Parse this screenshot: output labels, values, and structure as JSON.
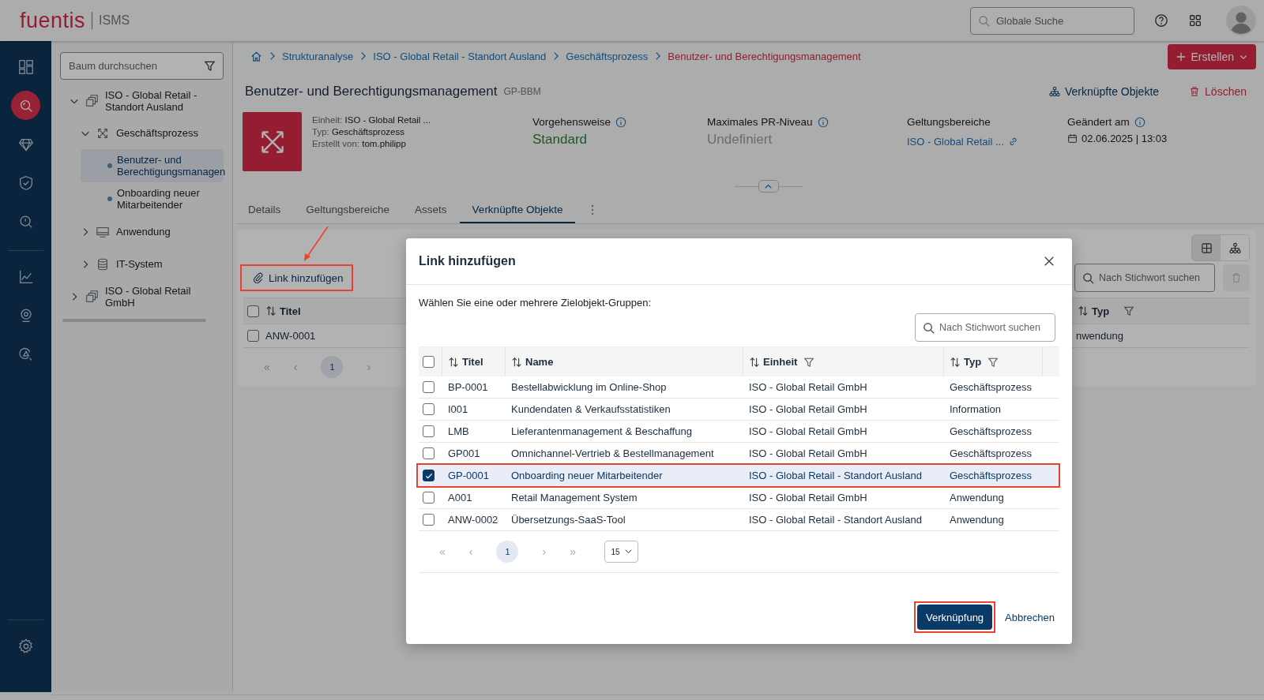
{
  "header": {
    "logo": "fuentis",
    "product": "ISMS",
    "search": {
      "placeholder": "Globale Suche"
    }
  },
  "nav_rail": {
    "top": [
      {
        "kind": "dashboard",
        "selected": false
      },
      {
        "kind": "search",
        "selected": true
      },
      {
        "kind": "gem",
        "selected": false
      },
      {
        "kind": "shield",
        "selected": false
      },
      {
        "kind": "alert-search",
        "selected": false
      }
    ],
    "middle": [
      {
        "kind": "chart",
        "selected": false
      },
      {
        "kind": "webcam",
        "selected": false
      },
      {
        "kind": "risk-search",
        "selected": false
      }
    ],
    "bottom": [
      {
        "kind": "settings",
        "selected": false
      }
    ]
  },
  "tree": {
    "search": {
      "placeholder": "Baum durchsuchen"
    },
    "items": [
      {
        "label": "ISO - Global Retail - Standort Ausland",
        "kind": "group",
        "expanded": true,
        "children": [
          {
            "label": "Geschäftsprozess",
            "kind": "process",
            "expanded": true,
            "children": [
              {
                "label": "Benutzer- und Berechtigungsmanagen",
                "kind": "leaf",
                "selected": true
              },
              {
                "label": "Onboarding neuer Mitarbeitender",
                "kind": "leaf",
                "selected": false
              }
            ]
          },
          {
            "label": "Anwendung",
            "kind": "application",
            "expanded": false
          },
          {
            "label": "IT-System",
            "kind": "database",
            "expanded": false
          }
        ]
      },
      {
        "label": "ISO - Global Retail GmbH",
        "kind": "group",
        "expanded": false
      }
    ]
  },
  "breadcrumb": [
    {
      "label": "Strukturanalyse",
      "current": false
    },
    {
      "label": "ISO - Global Retail - Standort Ausland",
      "current": false
    },
    {
      "label": "Geschäftsprozess",
      "current": false
    },
    {
      "label": "Benutzer- und Berechtigungsmanagement",
      "current": true
    }
  ],
  "create_button": "Erstellen",
  "object": {
    "title": "Benutzer- und Berechtigungsmanagement",
    "code": "GP-BBM",
    "actions": [
      {
        "label": "Verknüpfte Objekte",
        "kind": "links"
      },
      {
        "label": "Löschen",
        "kind": "delete"
      }
    ],
    "meta": [
      {
        "label": "Einheit:",
        "value": "ISO - Global Retail ..."
      },
      {
        "label": "Typ:",
        "value": "Geschäftsprozess"
      },
      {
        "label": "Erstellt von:",
        "value": "tom.philipp"
      }
    ],
    "fields": [
      {
        "label": "Vorgehensweise",
        "info": true,
        "kind": "status",
        "value": "Standard"
      },
      {
        "label": "Maximales PR-Niveau",
        "info": true,
        "kind": "empty",
        "value": "Undefiniert"
      },
      {
        "label": "Geltungsbereiche",
        "info": false,
        "kind": "link",
        "value": "ISO - Global Retail ..."
      },
      {
        "label": "Geändert am",
        "info": true,
        "kind": "date",
        "value": "02.06.2025 | 13:03"
      }
    ]
  },
  "tabs": [
    {
      "label": "Details",
      "selected": false
    },
    {
      "label": "Geltungsbereiche",
      "selected": false
    },
    {
      "label": "Assets",
      "selected": false
    },
    {
      "label": "Verknüpfte Objekte",
      "selected": true
    }
  ],
  "linked": {
    "add_button": {
      "label": "Link hinzufügen",
      "highlighted": true
    },
    "view_toggle": [
      {
        "kind": "table",
        "selected": true
      },
      {
        "kind": "hierarchy",
        "selected": false
      }
    ],
    "search": {
      "placeholder": "Nach Stichwort suchen"
    },
    "columns": [
      {
        "label": "Titel",
        "filter": false
      },
      {
        "label": "Typ",
        "filter": true
      }
    ],
    "all_checked": false,
    "rows": [
      {
        "title": "ANW-0001",
        "type": "nwendung",
        "checked": false
      }
    ],
    "pagination": {
      "first": "«",
      "prev": "‹",
      "next": "›",
      "pages": [
        {
          "label": "1",
          "selected": true
        }
      ]
    }
  },
  "dialog": {
    "title": "Link hinzufügen",
    "instruction": "Wählen Sie eine oder mehrere Zielobjekt-Gruppen:",
    "search": {
      "placeholder": "Nach Stichwort suchen"
    },
    "columns": [
      {
        "label": "Titel",
        "filter": false
      },
      {
        "label": "Name",
        "filter": false
      },
      {
        "label": "Einheit",
        "filter": true
      },
      {
        "label": "Typ",
        "filter": true
      }
    ],
    "all_checked": false,
    "rows": [
      {
        "cells": [
          "BP-0001",
          "Bestellabwicklung im Online-Shop",
          "ISO - Global Retail GmbH",
          "Geschäftsprozess"
        ],
        "selected": false,
        "highlighted": false
      },
      {
        "cells": [
          "I001",
          "Kundendaten & Verkaufsstatistiken",
          "ISO - Global Retail GmbH",
          "Information"
        ],
        "selected": false,
        "highlighted": false
      },
      {
        "cells": [
          "LMB",
          "Lieferantenmanagement & Beschaffung",
          "ISO - Global Retail GmbH",
          "Geschäftsprozess"
        ],
        "selected": false,
        "highlighted": false
      },
      {
        "cells": [
          "GP001",
          "Omnichannel-Vertrieb & Bestellmanagement",
          "ISO - Global Retail GmbH",
          "Geschäftsprozess"
        ],
        "selected": false,
        "highlighted": false
      },
      {
        "cells": [
          "GP-0001",
          "Onboarding neuer Mitarbeitender",
          "ISO - Global Retail - Standort Ausland",
          "Geschäftsprozess"
        ],
        "selected": true,
        "highlighted": true
      },
      {
        "cells": [
          "A001",
          "Retail Management System",
          "ISO - Global Retail GmbH",
          "Anwendung"
        ],
        "selected": false,
        "highlighted": false
      },
      {
        "cells": [
          "ANW-0002",
          "Übersetzungs-SaaS-Tool",
          "ISO - Global Retail - Standort Ausland",
          "Anwendung"
        ],
        "selected": false,
        "highlighted": false
      }
    ],
    "pagination": {
      "first": "«",
      "prev": "‹",
      "next": "›",
      "last": "»",
      "pages": [
        {
          "label": "1",
          "selected": true
        }
      ],
      "page_size": "15"
    },
    "buttons": [
      {
        "label": "Verknüpfung",
        "kind": "primary",
        "highlighted": true
      },
      {
        "label": "Abbrechen",
        "kind": "link",
        "highlighted": false
      }
    ]
  }
}
